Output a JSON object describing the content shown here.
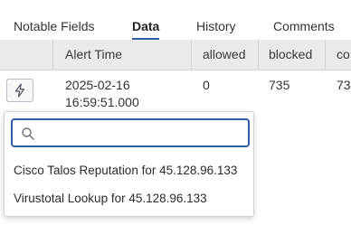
{
  "tabs": [
    {
      "label": "Notable Fields",
      "active": false
    },
    {
      "label": "Data",
      "active": true
    },
    {
      "label": "History",
      "active": false
    },
    {
      "label": "Comments",
      "active": false
    }
  ],
  "table": {
    "columns": [
      "",
      "Alert Time",
      "allowed",
      "blocked",
      "co"
    ],
    "row": {
      "alert_time_date": "2025-02-16",
      "alert_time_time": "16:59:51.000",
      "allowed": "0",
      "blocked": "735",
      "co": "73"
    }
  },
  "action_button": {
    "icon": "lightning-icon"
  },
  "dropdown": {
    "search": {
      "value": "",
      "placeholder": ""
    },
    "items": [
      "Cisco Talos Reputation for 45.128.96.133",
      "Virustotal Lookup for 45.128.96.133"
    ]
  },
  "colors": {
    "accent": "#2f5fa6",
    "header_bg": "#e9eaec"
  }
}
